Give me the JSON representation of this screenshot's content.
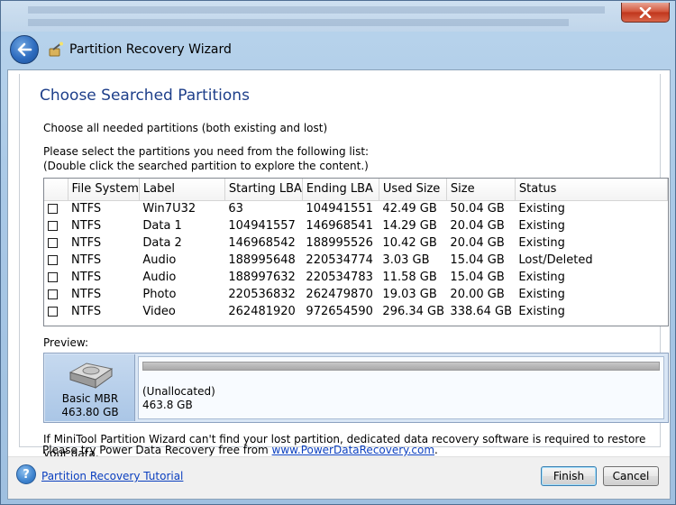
{
  "window": {
    "title": "Partition Recovery Wizard",
    "close_glyph": "✕"
  },
  "page": {
    "heading": "Choose Searched Partitions",
    "subtitle": "Choose all needed partitions (both existing and lost)",
    "instruction_line1": "Please select the partitions you need from the following list:",
    "instruction_line2": "(Double click the searched partition to explore the content.)"
  },
  "table": {
    "columns": [
      "File System",
      "Label",
      "Starting LBA",
      "Ending LBA",
      "Used Size",
      "Size",
      "Status"
    ],
    "rows": [
      {
        "checked": false,
        "fs": "NTFS",
        "label": "Win7U32",
        "start": "63",
        "end": "104941551",
        "used": "42.49 GB",
        "size": "50.04 GB",
        "status": "Existing"
      },
      {
        "checked": false,
        "fs": "NTFS",
        "label": "Data 1",
        "start": "104941557",
        "end": "146968541",
        "used": "14.29 GB",
        "size": "20.04 GB",
        "status": "Existing"
      },
      {
        "checked": false,
        "fs": "NTFS",
        "label": "Data 2",
        "start": "146968542",
        "end": "188995526",
        "used": "10.42 GB",
        "size": "20.04 GB",
        "status": "Existing"
      },
      {
        "checked": false,
        "fs": "NTFS",
        "label": "Audio",
        "start": "188995648",
        "end": "220534774",
        "used": "3.03 GB",
        "size": "15.04 GB",
        "status": "Lost/Deleted"
      },
      {
        "checked": false,
        "fs": "NTFS",
        "label": "Audio",
        "start": "188997632",
        "end": "220534783",
        "used": "11.58 GB",
        "size": "15.04 GB",
        "status": "Existing"
      },
      {
        "checked": false,
        "fs": "NTFS",
        "label": "Photo",
        "start": "220536832",
        "end": "262479870",
        "used": "19.03 GB",
        "size": "20.00 GB",
        "status": "Existing"
      },
      {
        "checked": false,
        "fs": "NTFS",
        "label": "Video",
        "start": "262481920",
        "end": "972654590",
        "used": "296.34 GB",
        "size": "338.64 GB",
        "status": "Existing"
      }
    ]
  },
  "preview": {
    "label": "Preview:",
    "disk_type": "Basic MBR",
    "disk_size": "463.80 GB",
    "partition_name": "(Unallocated)",
    "partition_size": "463.8 GB"
  },
  "notice": {
    "line1": "If MiniTool Partition Wizard can't find your lost partition, dedicated data recovery software is required to restore your data.",
    "line2_prefix": "Please try Power Data Recovery free from ",
    "link": "www.PowerDataRecovery.com",
    "line2_suffix": "."
  },
  "footer": {
    "help_glyph": "?",
    "tutorial_link": "Partition Recovery Tutorial",
    "finish_label": "Finish",
    "cancel_label": "Cancel"
  },
  "colors": {
    "heading": "#1e3f8a",
    "link": "#0b3fbf",
    "close_button": "#c0361c"
  }
}
